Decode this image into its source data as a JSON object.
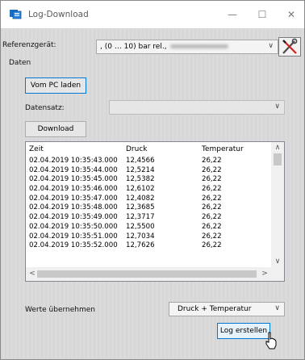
{
  "window": {
    "title": "Log-Download",
    "minimize_glyph": "—",
    "maximize_glyph": "☐",
    "close_glyph": "✕"
  },
  "reference": {
    "label": "Referenzgerät:",
    "device_value": ", (0 … 10) bar rel.,",
    "tool_icon": "wrench-screwdriver-icon"
  },
  "data_group": {
    "label": "Daten",
    "load_button": "Vom PC laden",
    "dataset_label": "Datensatz:",
    "dataset_value": "",
    "download_button": "Download"
  },
  "log_table": {
    "columns": [
      "Zeit",
      "Druck",
      "Temperatur"
    ],
    "rows": [
      [
        "02.04.2019 10:35:43.000",
        "12,4566",
        "26,22"
      ],
      [
        "02.04.2019 10:35:44.000",
        "12,5214",
        "26,22"
      ],
      [
        "02.04.2019 10:35:45.000",
        "12,5382",
        "26,22"
      ],
      [
        "02.04.2019 10:35:46.000",
        "12,6102",
        "26,22"
      ],
      [
        "02.04.2019 10:35:47.000",
        "12,4082",
        "26,22"
      ],
      [
        "02.04.2019 10:35:48.000",
        "12,3685",
        "26,22"
      ],
      [
        "02.04.2019 10:35:49.000",
        "12,3717",
        "26,22"
      ],
      [
        "02.04.2019 10:35:50.000",
        "12,5500",
        "26,22"
      ],
      [
        "02.04.2019 10:35:51.000",
        "12,7034",
        "26,22"
      ],
      [
        "02.04.2019 10:35:52.000",
        "12,7626",
        "26,22"
      ]
    ]
  },
  "export": {
    "label": "Werte übernehmen",
    "mode_value": "Druck + Temperatur",
    "create_button": "Log erstellen"
  },
  "colors": {
    "focus_border": "#0078d7",
    "app_icon_blue": "#1e6fc2"
  }
}
